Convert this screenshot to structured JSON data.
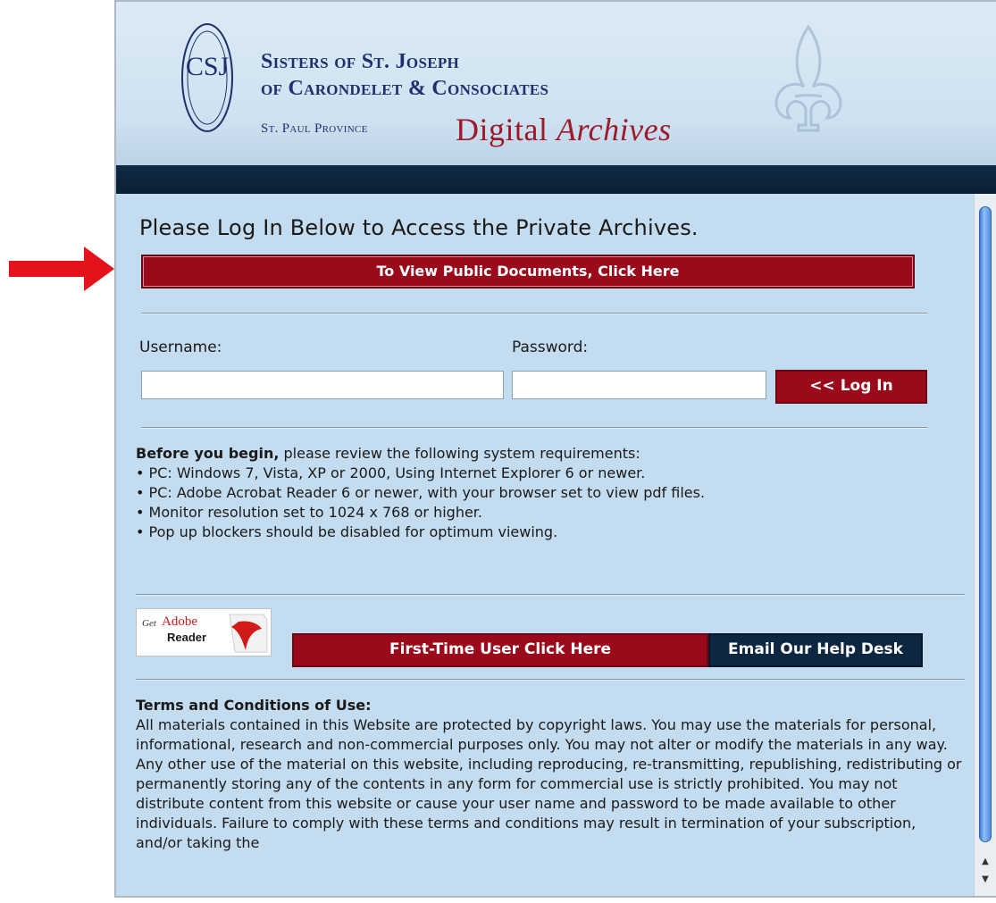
{
  "header": {
    "logo_letters": "CSJ",
    "org_line1": "Sisters of St. Joseph",
    "org_line2": "of Carondelet & Consociates",
    "province": "St. Paul Province",
    "title_word1": "Digital",
    "title_word2": "Archives"
  },
  "main": {
    "heading": "Please Log In Below to Access the Private Archives.",
    "public_button": "To View Public Documents, Click Here",
    "login": {
      "username_label": "Username:",
      "password_label": "Password:",
      "username_value": "",
      "password_value": "",
      "login_button": "<< Log In"
    },
    "requirements": {
      "intro_bold": "Before you begin,",
      "intro_rest": " please review the following system requirements:",
      "items": [
        "• PC: Windows 7, Vista, XP or 2000, Using Internet Explorer 6 or newer.",
        "• PC: Adobe Acrobat Reader 6 or newer, with your browser set to view pdf files.",
        "• Monitor resolution set to 1024 x 768 or higher.",
        "• Pop up blockers should be disabled for optimum viewing."
      ]
    },
    "adobe_badge": {
      "get": "Get",
      "brand": "Adobe",
      "product": "Reader"
    },
    "first_time_button": "First-Time User Click Here",
    "help_button": "Email Our Help Desk",
    "terms": {
      "title": "Terms and Conditions of Use:",
      "body": "All materials contained in this Website are protected by copyright laws. You may use the materials for personal, informational, research and non-commercial purposes only. You may not alter or modify the materials in any way. Any other use of the material on this website, including reproducing, re-transmitting, republishing, redistributing or permanently storing any of the contents in any form for commercial use is strictly prohibited. You may not distribute content from this website or cause your user name and password to be made available to other individuals. Failure to comply with these terms and conditions may result in termination of your subscription, and/or taking the"
    }
  },
  "colors": {
    "button_red": "#9b0a1b",
    "button_navy": "#0e2741",
    "content_bg": "#c3dcef",
    "arrow_red": "#e3121b",
    "title_red": "#9b1a2b",
    "org_blue": "#1f2f6e"
  },
  "icons": {
    "annotation_arrow": "right-arrow-icon",
    "scroll_up": "scroll-up-arrow-icon",
    "scroll_down": "scroll-down-arrow-icon"
  }
}
